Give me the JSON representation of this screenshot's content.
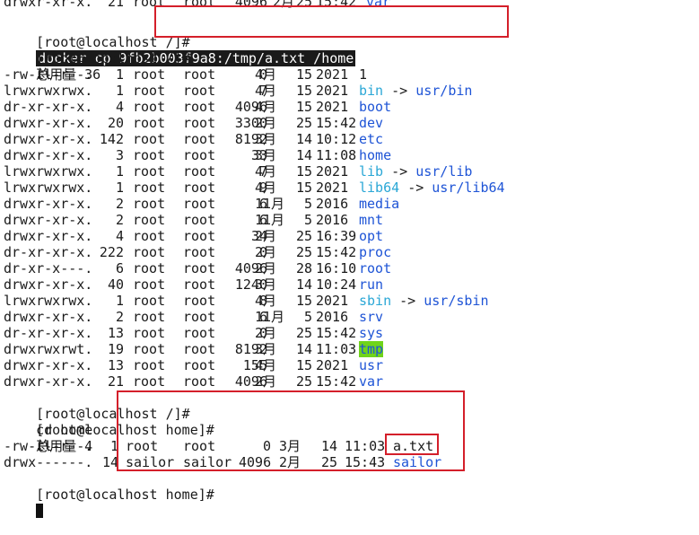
{
  "terminal": {
    "top_line": {
      "perm": "drwxr-xr-x.",
      "links": "21",
      "user": "root",
      "group": "root",
      "size": "4096",
      "month": "2月",
      "day": "25",
      "time": "15:42",
      "name": "var"
    },
    "prompt_root": "[root@localhost /]#",
    "command_docker": "docker cp 9fb2b003f9a8:/tmp/a.txt /home",
    "command_ll": "ll",
    "total_root": "总用量 36",
    "listing": [
      {
        "perm": "-rw-r--r--.",
        "links": "1",
        "user": "root",
        "group": "root",
        "size": "0",
        "month": "4月",
        "day": "15",
        "time": "2021",
        "name": "1",
        "type": "file"
      },
      {
        "perm": "lrwxrwxrwx.",
        "links": "1",
        "user": "root",
        "group": "root",
        "size": "7",
        "month": "4月",
        "day": "15",
        "time": "2021",
        "name": "bin",
        "target": "usr/bin",
        "type": "link"
      },
      {
        "perm": "dr-xr-xr-x.",
        "links": "4",
        "user": "root",
        "group": "root",
        "size": "4096",
        "month": "4月",
        "day": "15",
        "time": "2021",
        "name": "boot",
        "type": "dir"
      },
      {
        "perm": "drwxr-xr-x.",
        "links": "20",
        "user": "root",
        "group": "root",
        "size": "3300",
        "month": "2月",
        "day": "25",
        "time": "15:42",
        "name": "dev",
        "type": "dir"
      },
      {
        "perm": "drwxr-xr-x.",
        "links": "142",
        "user": "root",
        "group": "root",
        "size": "8192",
        "month": "3月",
        "day": "14",
        "time": "10:12",
        "name": "etc",
        "type": "dir"
      },
      {
        "perm": "drwxr-xr-x.",
        "links": "3",
        "user": "root",
        "group": "root",
        "size": "33",
        "month": "3月",
        "day": "14",
        "time": "11:08",
        "name": "home",
        "type": "dir"
      },
      {
        "perm": "lrwxrwxrwx.",
        "links": "1",
        "user": "root",
        "group": "root",
        "size": "7",
        "month": "4月",
        "day": "15",
        "time": "2021",
        "name": "lib",
        "target": "usr/lib",
        "type": "link"
      },
      {
        "perm": "lrwxrwxrwx.",
        "links": "1",
        "user": "root",
        "group": "root",
        "size": "9",
        "month": "4月",
        "day": "15",
        "time": "2021",
        "name": "lib64",
        "target": "usr/lib64",
        "type": "link"
      },
      {
        "perm": "drwxr-xr-x.",
        "links": "2",
        "user": "root",
        "group": "root",
        "size": "6",
        "month": "11月",
        "day": "5",
        "time": "2016",
        "name": "media",
        "type": "dir"
      },
      {
        "perm": "drwxr-xr-x.",
        "links": "2",
        "user": "root",
        "group": "root",
        "size": "6",
        "month": "11月",
        "day": "5",
        "time": "2016",
        "name": "mnt",
        "type": "dir"
      },
      {
        "perm": "drwxr-xr-x.",
        "links": "4",
        "user": "root",
        "group": "root",
        "size": "34",
        "month": "2月",
        "day": "25",
        "time": "16:39",
        "name": "opt",
        "type": "dir"
      },
      {
        "perm": "dr-xr-xr-x.",
        "links": "222",
        "user": "root",
        "group": "root",
        "size": "0",
        "month": "2月",
        "day": "25",
        "time": "15:42",
        "name": "proc",
        "type": "dir"
      },
      {
        "perm": "dr-xr-x---.",
        "links": "6",
        "user": "root",
        "group": "root",
        "size": "4096",
        "month": "2月",
        "day": "28",
        "time": "16:10",
        "name": "root",
        "type": "dir"
      },
      {
        "perm": "drwxr-xr-x.",
        "links": "40",
        "user": "root",
        "group": "root",
        "size": "1240",
        "month": "3月",
        "day": "14",
        "time": "10:24",
        "name": "run",
        "type": "dir"
      },
      {
        "perm": "lrwxrwxrwx.",
        "links": "1",
        "user": "root",
        "group": "root",
        "size": "8",
        "month": "4月",
        "day": "15",
        "time": "2021",
        "name": "sbin",
        "target": "usr/sbin",
        "type": "link"
      },
      {
        "perm": "drwxr-xr-x.",
        "links": "2",
        "user": "root",
        "group": "root",
        "size": "6",
        "month": "11月",
        "day": "5",
        "time": "2016",
        "name": "srv",
        "type": "dir"
      },
      {
        "perm": "dr-xr-xr-x.",
        "links": "13",
        "user": "root",
        "group": "root",
        "size": "0",
        "month": "2月",
        "day": "25",
        "time": "15:42",
        "name": "sys",
        "type": "dir"
      },
      {
        "perm": "drwxrwxrwt.",
        "links": "19",
        "user": "root",
        "group": "root",
        "size": "8192",
        "month": "3月",
        "day": "14",
        "time": "11:03",
        "name": "tmp",
        "type": "tmp"
      },
      {
        "perm": "drwxr-xr-x.",
        "links": "13",
        "user": "root",
        "group": "root",
        "size": "155",
        "month": "4月",
        "day": "15",
        "time": "2021",
        "name": "usr",
        "type": "dir"
      },
      {
        "perm": "drwxr-xr-x.",
        "links": "21",
        "user": "root",
        "group": "root",
        "size": "4096",
        "month": "2月",
        "day": "25",
        "time": "15:42",
        "name": "var",
        "type": "dir"
      }
    ],
    "link_arrow": "->",
    "command_cd": "cd home",
    "prompt_home": "[root@localhost home]#",
    "total_home": "总用量 4",
    "home_listing": [
      {
        "perm": "-rw-r--r--.",
        "links": "1",
        "user": "root",
        "group": "root",
        "size": "0",
        "month": "3月",
        "day": "14",
        "time": "11:03",
        "name": "a.txt",
        "type": "file"
      },
      {
        "perm": "drwx------.",
        "links": "14",
        "user": "sailor",
        "group": "sailor",
        "size": "4096",
        "month": "2月",
        "day": "25",
        "time": "15:43",
        "name": "sailor",
        "type": "dir"
      }
    ]
  },
  "colors": {
    "directory": "#1e54d6",
    "symlink": "#2aa7d6",
    "sticky_dir_bg": "#6fd41a",
    "annotation_box": "#d41f2a",
    "text": "#1a1a1a",
    "background": "#ffffff"
  }
}
